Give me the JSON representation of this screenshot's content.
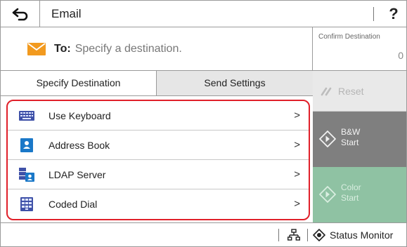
{
  "header": {
    "title": "Email",
    "help_label": "?"
  },
  "destination": {
    "to_label": "To:",
    "to_placeholder": "Specify a destination.",
    "confirm_label": "Confirm Destination",
    "confirm_count": "0"
  },
  "tabs": [
    {
      "label": "Specify Destination",
      "active": true
    },
    {
      "label": "Send Settings",
      "active": false
    }
  ],
  "destination_methods": [
    {
      "label": "Use Keyboard",
      "icon": "keyboard-icon",
      "chevron": ">"
    },
    {
      "label": "Address Book",
      "icon": "address-book-icon",
      "chevron": ">"
    },
    {
      "label": "LDAP Server",
      "icon": "ldap-server-icon",
      "chevron": ">"
    },
    {
      "label": "Coded Dial",
      "icon": "coded-dial-icon",
      "chevron": ">"
    }
  ],
  "actions": {
    "reset_label": "Reset",
    "bw_start_line1": "B&W",
    "bw_start_line2": "Start",
    "color_start_line1": "Color",
    "color_start_line2": "Start"
  },
  "status_bar": {
    "status_monitor_label": "Status Monitor"
  },
  "colors": {
    "highlight_border": "#e0202a",
    "bw_start": "#7f7f7f",
    "color_start": "#8fc2a3",
    "icon_blue": "#1a78c8",
    "mail_orange": "#f29a1f"
  }
}
